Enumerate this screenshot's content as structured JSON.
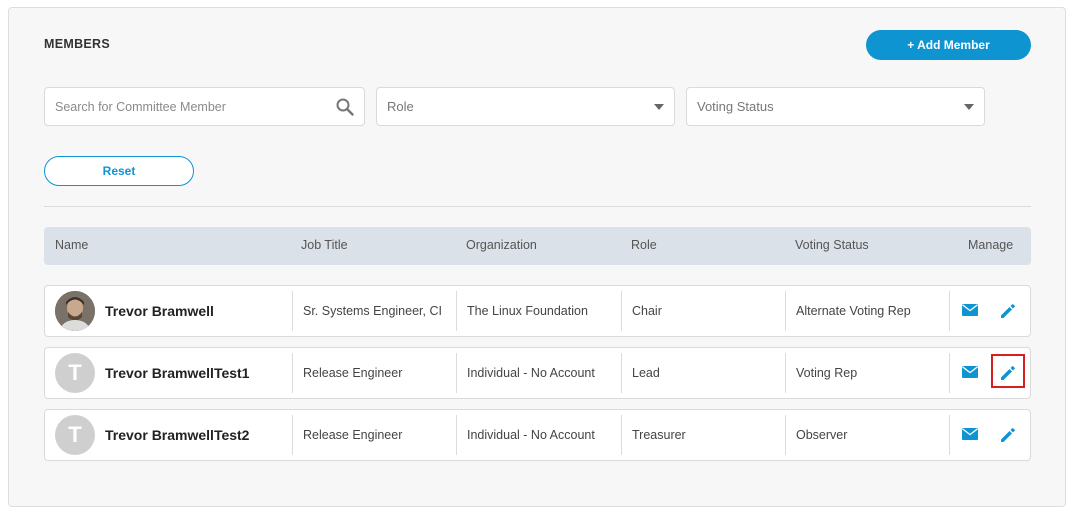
{
  "header": {
    "title": "MEMBERS",
    "add_button_label": "+ Add Member"
  },
  "filters": {
    "search_placeholder": "Search for Committee Member",
    "role_placeholder": "Role",
    "voting_placeholder": "Voting Status",
    "reset_label": "Reset"
  },
  "table": {
    "columns": [
      "Name",
      "Job Title",
      "Organization",
      "Role",
      "Voting Status",
      "Manage"
    ],
    "rows": [
      {
        "name": "Trevor Bramwell",
        "avatar": "photo",
        "job_title": "Sr. Systems Engineer, CI",
        "organization": "The Linux Foundation",
        "role": "Chair",
        "voting_status": "Alternate Voting Rep"
      },
      {
        "name": "Trevor BramwellTest1",
        "avatar": "T",
        "job_title": "Release Engineer",
        "organization": "Individual - No Account",
        "role": "Lead",
        "voting_status": "Voting Rep"
      },
      {
        "name": "Trevor BramwellTest2",
        "avatar": "T",
        "job_title": "Release Engineer",
        "organization": "Individual - No Account",
        "role": "Treasurer",
        "voting_status": "Observer"
      }
    ]
  },
  "colors": {
    "accent": "#0f94d2",
    "highlight": "#d62020"
  },
  "icons": {
    "search": "search-icon",
    "dropdown": "caret-down-icon",
    "email": "envelope-icon",
    "edit": "pencil-icon"
  }
}
